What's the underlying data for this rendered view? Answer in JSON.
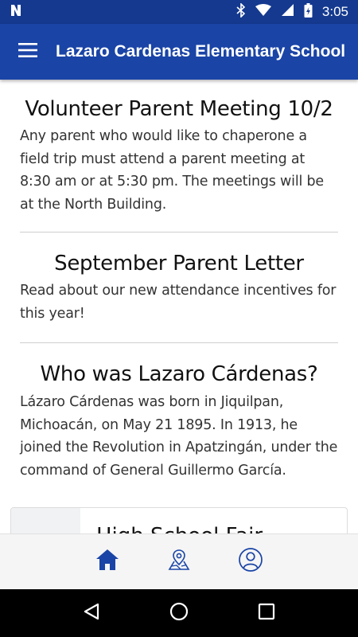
{
  "status_bar": {
    "time": "3:05",
    "icons": [
      "n-notification-icon",
      "bluetooth-icon",
      "wifi-icon",
      "cell-signal-icon",
      "battery-icon"
    ]
  },
  "app_bar": {
    "title": "Lazaro Cardenas Elementary School",
    "menu_icon": "hamburger-menu-icon"
  },
  "articles": [
    {
      "title": "Volunteer Parent Meeting 10/2",
      "body": "Any parent who would like to chaperone a field trip must attend a parent meeting at 8:30 am or at 5:30 pm. The meetings will be at the North Building."
    },
    {
      "title": "September Parent Letter",
      "body": "Read about our new attendance incentives for this year!"
    },
    {
      "title": "Who was Lazaro Cárdenas?",
      "body": "Lázaro Cárdenas was born in Jiquilpan, Michoacán, on May 21 1895. In 1913, he joined the Revolution in Apatzingán, under the command of General Guillermo García."
    }
  ],
  "card": {
    "title": "High School Fair"
  },
  "bottom_nav": {
    "items": [
      {
        "icon": "home-icon",
        "active": true
      },
      {
        "icon": "map-location-icon",
        "active": false
      },
      {
        "icon": "profile-icon",
        "active": false
      }
    ]
  },
  "system_nav": {
    "buttons": [
      "back-icon",
      "home-circle-icon",
      "recents-icon"
    ]
  },
  "colors": {
    "status_bar": "#14398f",
    "app_bar": "#1a44a6",
    "nav_icon": "#1a44a6",
    "bottom_nav_bg": "#f5f5f5"
  }
}
